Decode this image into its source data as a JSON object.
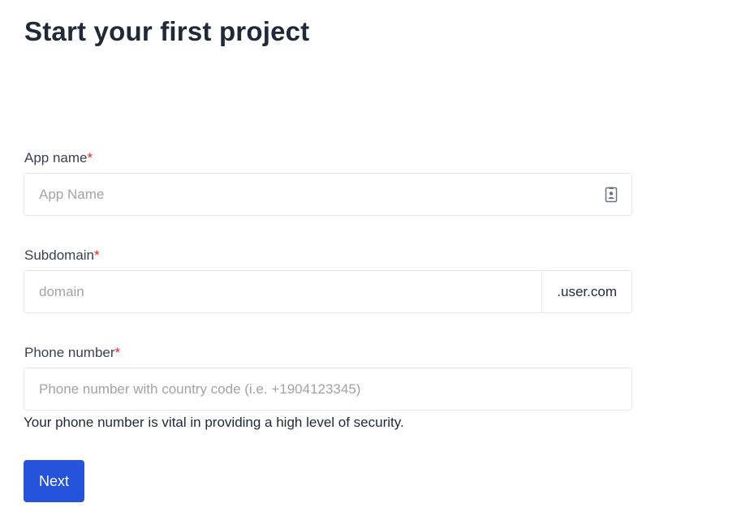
{
  "page": {
    "title": "Start your first project"
  },
  "form": {
    "app_name": {
      "label": "App name",
      "required_mark": "*",
      "placeholder": "App Name",
      "value": "",
      "icon": "contact-card-icon"
    },
    "subdomain": {
      "label": "Subdomain",
      "required_mark": "*",
      "placeholder": "domain",
      "value": "",
      "suffix": ".user.com"
    },
    "phone": {
      "label": "Phone number",
      "required_mark": "*",
      "placeholder": "Phone number with country code (i.e. +1904123345)",
      "value": "",
      "hint": "Your phone number is vital in providing a high level of security."
    },
    "next_label": "Next"
  },
  "colors": {
    "primary": "#2553dc",
    "required": "#dc2626",
    "border": "#e5e7eb",
    "placeholder": "#a3a3a3"
  }
}
